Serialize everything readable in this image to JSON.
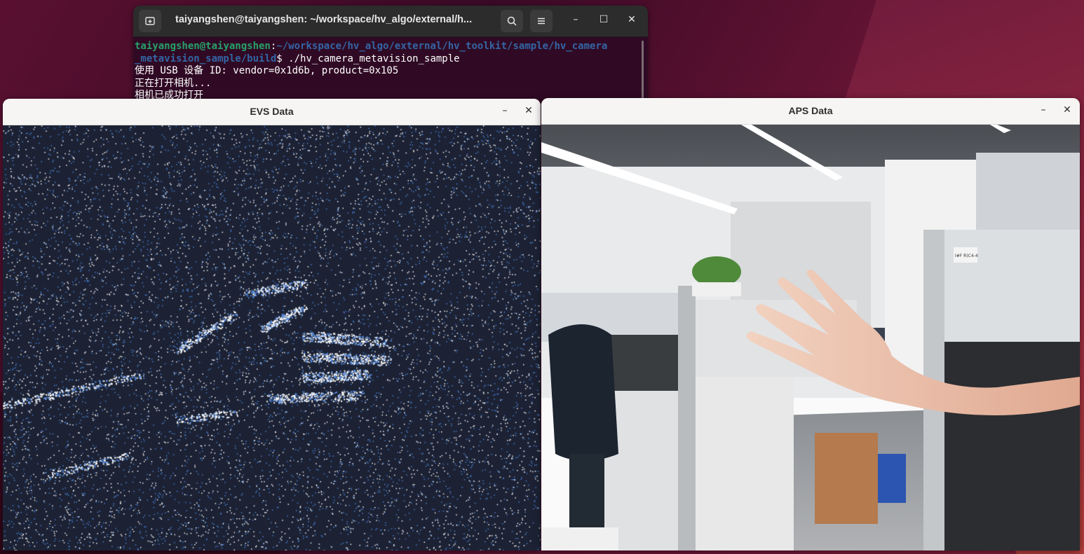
{
  "terminal": {
    "title": "taiyangshen@taiyangshen: ~/workspace/hv_algo/external/h...",
    "new_tab_icon": "new-tab-icon",
    "search_icon": "search-icon",
    "menu_icon": "hamburger-menu-icon",
    "minimize": "–",
    "maximize": "☐",
    "close": "✕",
    "prompt_user": "taiyangshen@taiyangshen",
    "prompt_sep": ":",
    "prompt_path_line1": "~/workspace/hv_algo/external/hv_toolkit/sample/hv_camera",
    "prompt_path_line2": "_metavision_sample/build",
    "prompt_dollar": "$ ",
    "command": "./hv_camera_metavision_sample",
    "output_lines": [
      "使用 USB 设备 ID: vendor=0x1d6b, product=0x105",
      "正在打开相机...",
      "相机已成功打开"
    ]
  },
  "evs_window": {
    "title": "EVS Data",
    "minimize": "–",
    "close": "✕",
    "background_color": "#1c2234"
  },
  "aps_window": {
    "title": "APS Data",
    "minimize": "–",
    "close": "✕",
    "label_text": "I#F R(C4-4"
  }
}
